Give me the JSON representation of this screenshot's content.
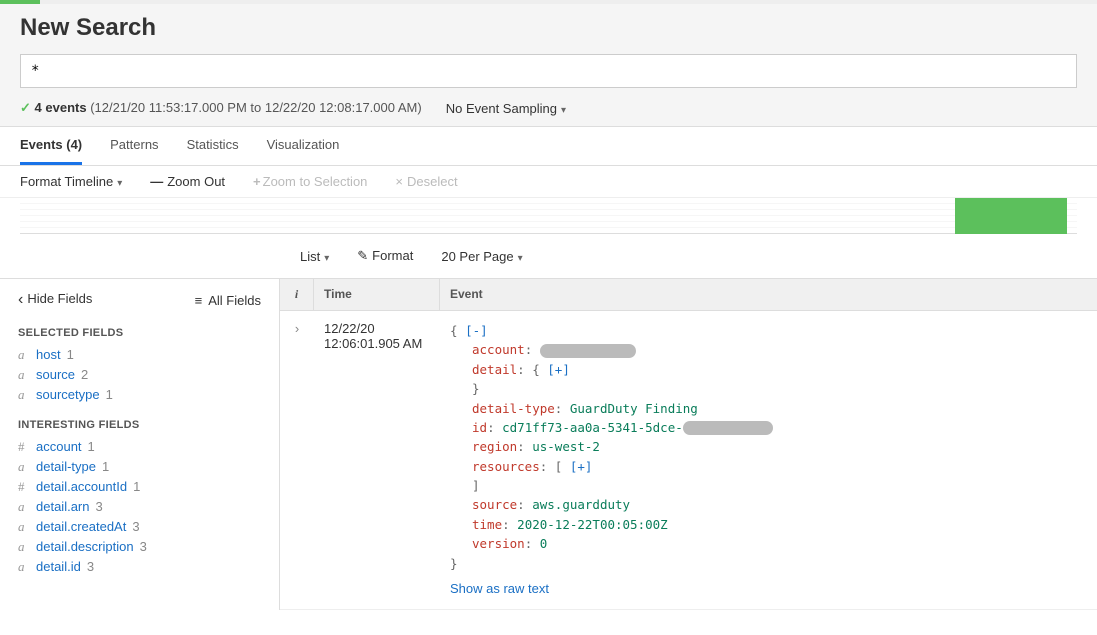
{
  "page_title": "New Search",
  "search_query": "*",
  "status": {
    "events_count_label": "4 events",
    "time_range": "(12/21/20 11:53:17.000 PM to 12/22/20 12:08:17.000 AM)",
    "sampling_label": "No Event Sampling"
  },
  "tabs": {
    "events": "Events (4)",
    "patterns": "Patterns",
    "statistics": "Statistics",
    "visualization": "Visualization"
  },
  "timeline": {
    "format": "Format Timeline",
    "zoom_out": "Zoom Out",
    "zoom_sel": "Zoom to Selection",
    "deselect": "Deselect"
  },
  "view_controls": {
    "list": "List",
    "format": "Format",
    "per_page": "20 Per Page"
  },
  "sidebar": {
    "hide": "Hide Fields",
    "all": "All Fields",
    "selected_heading": "SELECTED FIELDS",
    "interesting_heading": "INTERESTING FIELDS",
    "selected": [
      {
        "type": "a",
        "name": "host",
        "count": "1"
      },
      {
        "type": "a",
        "name": "source",
        "count": "2"
      },
      {
        "type": "a",
        "name": "sourcetype",
        "count": "1"
      }
    ],
    "interesting": [
      {
        "type": "#",
        "name": "account",
        "count": "1"
      },
      {
        "type": "a",
        "name": "detail-type",
        "count": "1"
      },
      {
        "type": "#",
        "name": "detail.accountId",
        "count": "1"
      },
      {
        "type": "a",
        "name": "detail.arn",
        "count": "3"
      },
      {
        "type": "a",
        "name": "detail.createdAt",
        "count": "3"
      },
      {
        "type": "a",
        "name": "detail.description",
        "count": "3"
      },
      {
        "type": "a",
        "name": "detail.id",
        "count": "3"
      }
    ]
  },
  "table": {
    "headers": {
      "info": "i",
      "time": "Time",
      "event": "Event"
    },
    "row": {
      "date": "12/22/20",
      "time": "12:06:01.905 AM",
      "json": {
        "toggle_collapse": "[-]",
        "toggle_expand": "[+]",
        "account_key": "account",
        "detail_key": "detail",
        "detail_type_key": "detail-type",
        "detail_type_val": "GuardDuty Finding",
        "id_key": "id",
        "id_val": "cd71ff73-aa0a-5341-5dce-",
        "region_key": "region",
        "region_val": "us-west-2",
        "resources_key": "resources",
        "source_key": "source",
        "source_val": "aws.guardduty",
        "time_key": "time",
        "time_val": "2020-12-22T00:05:00Z",
        "version_key": "version",
        "version_val": "0"
      },
      "raw_link": "Show as raw text"
    }
  }
}
